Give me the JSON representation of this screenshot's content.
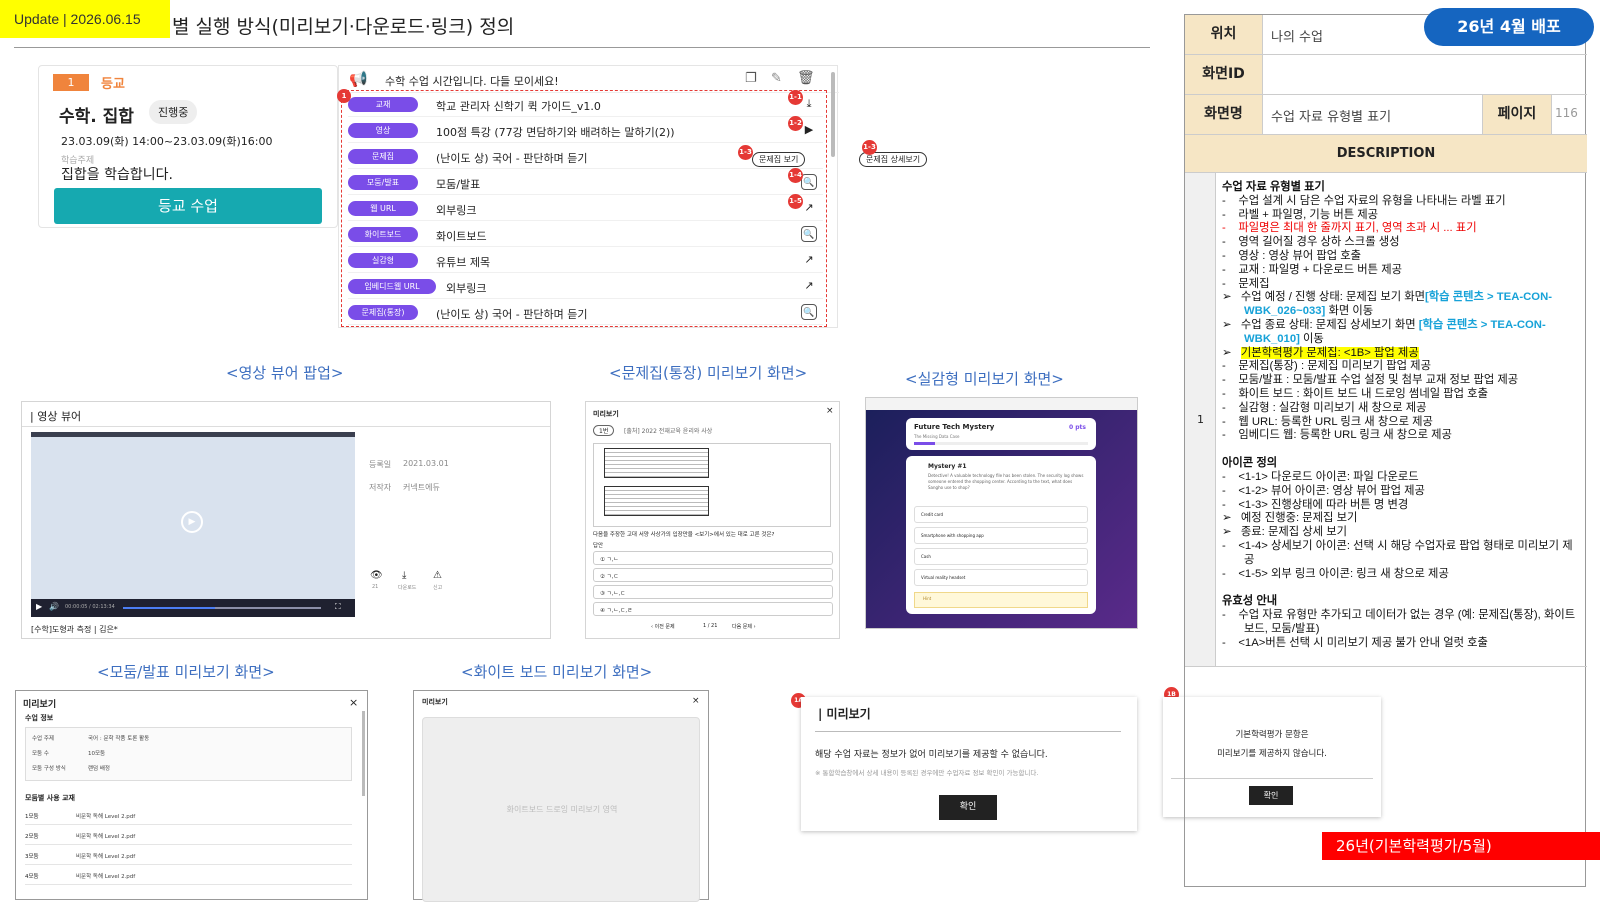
{
  "header": {
    "update": "Update | 2026.06.15",
    "title": "별 실행 방식(미리보기·다운로드·링크) 정의"
  },
  "card": {
    "grade": "1",
    "label": "등교",
    "subject": "수학. 집합",
    "status": "진행중",
    "date": "23.03.09(화) 14:00~23.03.09(화)16:00",
    "topic_label": "학습주제",
    "topic": "집합을 학습합니다.",
    "button": "등교 수업"
  },
  "list": {
    "notice": "수학 수업 시간입니다. 다들 모이세요!",
    "rows": [
      {
        "tag": "교재",
        "text": "학교 관리자 신학기 퀵 가이드_v1.0",
        "icon": "download-icon",
        "num": "1-1"
      },
      {
        "tag": "영상",
        "text": "100점 특강 (77강 면담하기와 배려하는 말하기(2))",
        "icon": "video-icon",
        "num": "1-2"
      },
      {
        "tag": "문제집",
        "text": "(난이도 상) 국어 - 판단하며 듣기",
        "icon": "",
        "num": "1-3"
      },
      {
        "tag": "모둠/발표",
        "text": "모둠/발표",
        "icon": "search-icon",
        "num": "1-4"
      },
      {
        "tag": "웹 URL",
        "text": "외부링크",
        "icon": "external-link-icon",
        "num": "1-5"
      },
      {
        "tag": "화이트보드",
        "text": "화이트보드",
        "icon": "search-icon",
        "num": ""
      },
      {
        "tag": "실감형",
        "text": "유튜브 제목",
        "icon": "external-link-icon",
        "num": ""
      },
      {
        "tag": "임베디드웹 URL",
        "text": "외부링크",
        "icon": "external-link-icon",
        "num": ""
      },
      {
        "tag": "문제집(통장)",
        "text": "(난이도 상) 국어 - 판단하며 듣기",
        "icon": "search-icon",
        "num": ""
      }
    ],
    "btn_view": "문제집 보기",
    "btn_detail": "문제집 상세보기",
    "callout1": "1",
    "callout2": "1-3",
    "callout3": "1-3"
  },
  "sections": {
    "video": "<영상 뷰어 팝업>",
    "quiz": "<문제집(통장) 미리보기 화면>",
    "vr": "<실감형 미리보기 화면>",
    "group": "<모둠/발표 미리보기 화면>",
    "wb": "<화이트 보드 미리보기 화면>"
  },
  "video": {
    "title": "| 영상 뷰어",
    "reg_label": "등록일",
    "reg": "2021.03.01",
    "author_label": "저작자",
    "author": "커넥트에듀",
    "time": "00:00:05 / 02:13:34",
    "caption": "[수학]도형과 측정 | 김은*",
    "stat1": "21",
    "stat2": "다운로드",
    "stat3": "신고"
  },
  "quiz": {
    "title": "미리보기",
    "chip": "1번",
    "head": "[출처] 2022 전재교육 윤리와 사상",
    "q": "다음을 주장한 고대 서양 사상가의 입장만을 <보기>에서 있는 대로 고른 것은?",
    "answer": "답안",
    "opts": [
      "① ㄱ,ㄴ",
      "② ㄱ,ㄷ",
      "③ ㄱ,ㄴ,ㄷ",
      "④ ㄱ,ㄴ,ㄷ,ㄹ"
    ],
    "prev": "이전 문제",
    "page": "1 / 21",
    "next": "다음 문제"
  },
  "vr": {
    "app": "Future Tech Mystery",
    "sub": "The Missing Data Case",
    "pts": "0 pts",
    "mystery": "Mystery #1",
    "story": "Detective! A valuable technology file has been stolen. The security log shows someone entered the shopping center. According to the text, what does Sangho use to shop?",
    "opts": [
      "Credit card",
      "Smartphone with shopping app",
      "Cash",
      "Virtual reality headset"
    ],
    "hint": "Hint"
  },
  "group": {
    "title": "미리보기",
    "info": "수업 정보",
    "rows": [
      [
        "수업 주제",
        "국어 : 문학 작품 토론 활동"
      ],
      [
        "모둠 수",
        "10모둠"
      ],
      [
        "모둠 구성 방식",
        "랜덤 배정"
      ]
    ],
    "mat": "모둠별 사용 교재",
    "items": [
      [
        "1모둠",
        "비문학 독해 Level 2.pdf"
      ],
      [
        "2모둠",
        "비문학 독해 Level 2.pdf"
      ],
      [
        "3모둠",
        "비문학 독해 Level 2.pdf"
      ],
      [
        "4모둠",
        "비문학 독해 Level 2.pdf"
      ]
    ]
  },
  "wb": {
    "title": "미리보기",
    "area": "화이트보드 드로잉 미리보기 영역"
  },
  "popA": {
    "num": "1A",
    "title": "| 미리보기",
    "msg": "해당 수업 자료는 정보가 없어 미리보기를 제공할 수 없습니다.",
    "note": "※ 통합학습창에서 상세 내용이 등록된 경우에만 수업자료 정보 확인이 가능합니다.",
    "btn": "확인"
  },
  "popB": {
    "num": "1B",
    "l1": "기본학력평가 문항은",
    "l2": "미리보기를 제공하지 않습니다.",
    "btn": "확인"
  },
  "side": {
    "loc_label": "위치",
    "loc": "나의 수업",
    "release": "26년 4월 배포",
    "id_label": "화면ID",
    "id": "",
    "name_label": "화면명",
    "name": "수업 자료 유형별 표기",
    "page_label": "페이지",
    "page": "116",
    "desc_label": "DESCRIPTION",
    "rownum": "1",
    "tag": "26년(기본학력평가/5월)"
  },
  "desc": [
    {
      "t": "h",
      "s": "수업 자료 유형별 표기"
    },
    {
      "t": "n",
      "s": "-    수업 설계 시 담은 수업 자료의 유형을 나타내는 라벨 표기"
    },
    {
      "t": "n",
      "s": "-    라벨 + 파일명, 기능 버튼 제공"
    },
    {
      "t": "r",
      "s": "-    파일명은 최대 한 줄까지 표기, 영역 초과 시 ... 표기"
    },
    {
      "t": "n",
      "s": "-    영역 길어질 경우 상하 스크롤 생성"
    },
    {
      "t": "n",
      "s": "-    영상 : 영상 뷰어 팝업 호출"
    },
    {
      "t": "n",
      "s": "-    교재 : 파일명 + 다운로드 버튼 제공"
    },
    {
      "t": "n",
      "s": "-    문제집"
    },
    {
      "t": "b",
      "s": "➢   수업 예정 / 진행 상태: 문제집 보기 화면",
      "b": "[학습 콘텐츠 > TEA-CON-WBK_026~033]",
      "e": " 화면 이동"
    },
    {
      "t": "b",
      "s": "➢   수업 종료 상태: 문제집 상세보기 화면 ",
      "b": "[학습 콘텐츠 > TEA-CON-WBK_010]",
      "e": " 이동"
    },
    {
      "t": "y",
      "s": "➢   ",
      "y": "기본학력평가 문제집: <1B> 팝업 제공"
    },
    {
      "t": "n",
      "s": "-    문제집(통장) : 문제집 미리보기 팝업 제공"
    },
    {
      "t": "n",
      "s": "-    모둠/발표 : 모둠/발표 수업 설정 및 첨부 교재 정보 팝업 제공"
    },
    {
      "t": "n",
      "s": "-    화이트 보드 : 화이트 보드 내 드로잉 썸네일 팝업 호출"
    },
    {
      "t": "n",
      "s": "-    실감형 : 실감형 미리보기 새 창으로 제공"
    },
    {
      "t": "n",
      "s": "-    웹 URL: 등록한 URL 링크 새 창으로 제공"
    },
    {
      "t": "n",
      "s": "-    임베디드 웹: 등록한 URL 링크 새 창으로 제공"
    },
    {
      "t": "g",
      "s": ""
    },
    {
      "t": "h",
      "s": "아이콘 정의"
    },
    {
      "t": "n",
      "s": "-    <1-1> 다운로드 아이콘: 파일 다운로드"
    },
    {
      "t": "n",
      "s": "-    <1-2> 뷰어 아이콘: 영상 뷰어 팝업 제공"
    },
    {
      "t": "n",
      "s": "-    <1-3> 진행상태에 따라 버튼 명 변경"
    },
    {
      "t": "n",
      "s": "➢   예정 진행중: 문제집 보기"
    },
    {
      "t": "n",
      "s": "➢   종료: 문제집 상세 보기"
    },
    {
      "t": "n",
      "s": "-    <1-4> 상세보기 아이콘: 선택 시 해당 수업자료 팝업 형태로 미리보기 제공"
    },
    {
      "t": "n",
      "s": "-    <1-5> 외부 링크 아이콘: 링크 새 창으로 제공"
    },
    {
      "t": "g",
      "s": ""
    },
    {
      "t": "h",
      "s": "유효성 안내"
    },
    {
      "t": "n",
      "s": "-    수업 자료 유형만 추가되고 데이터가 없는 경우 (예: 문제집(통장), 화이트보드, 모둠/발표)"
    },
    {
      "t": "n",
      "s": "-    <1A>버튼 선택 시 미리보기 제공 불가 안내 얼럿 호출"
    }
  ],
  "colors": {
    "accent": "#7a4de8",
    "teal": "#16a9b0",
    "orange": "#f0843c",
    "red": "#e53935",
    "blue": "#1565c0"
  }
}
